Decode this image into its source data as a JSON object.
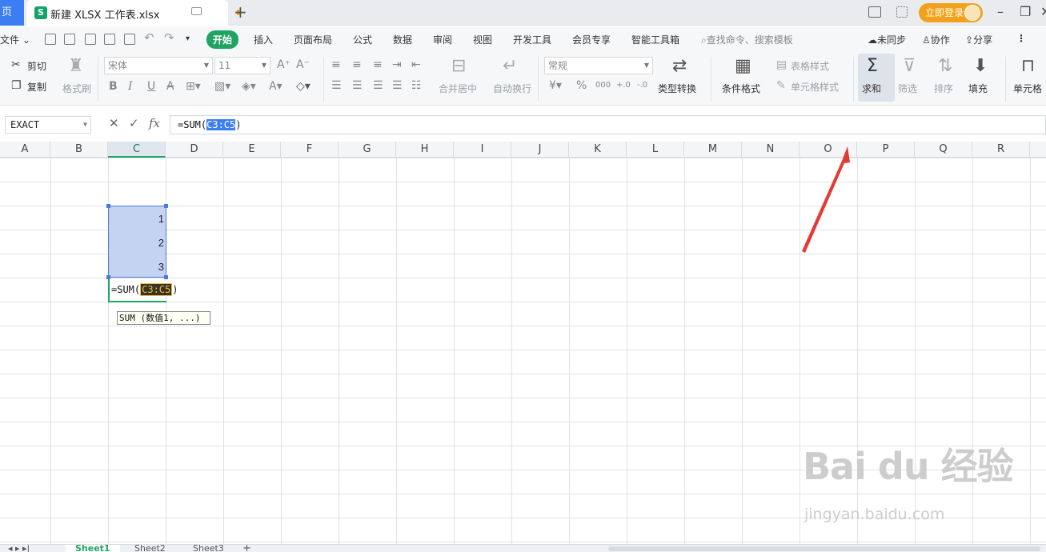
{
  "titlebar": {
    "home_label": "页",
    "doc_icon": "S",
    "doc_title": "新建 XLSX 工作表.xlsx",
    "new_tab": "+",
    "login_label": "立即登录"
  },
  "menu": {
    "file": "文件",
    "tabs": [
      "开始",
      "插入",
      "页面布局",
      "公式",
      "数据",
      "审阅",
      "视图",
      "开发工具",
      "会员专享",
      "智能工具箱"
    ],
    "search_placeholder": "查找命令、搜索模板",
    "sync": "未同步",
    "collab": "协作",
    "share": "分享"
  },
  "ribbon": {
    "cut": "剪切",
    "copy": "复制",
    "format_painter": "格式刷",
    "font_name": "宋体",
    "font_size": "11",
    "merge_center": "合并居中",
    "wrap_text": "自动换行",
    "number_format": "常规",
    "type_convert": "类型转换",
    "cond_format": "条件格式",
    "table_style": "表格样式",
    "cell_style": "单元格样式",
    "sum": "求和",
    "filter": "筛选",
    "sort": "排序",
    "fill": "填充",
    "cell": "单元格"
  },
  "formula_bar": {
    "name_box": "EXACT",
    "fx": "fx",
    "formula_prefix": "=SUM(",
    "formula_ref": "C3:C5",
    "formula_suffix": ")"
  },
  "sheet": {
    "columns": [
      "A",
      "B",
      "C",
      "D",
      "E",
      "F",
      "G",
      "H",
      "I",
      "J",
      "K",
      "L",
      "M",
      "N",
      "O",
      "P",
      "Q",
      "R"
    ],
    "active_column": "C",
    "cells": [
      "1",
      "2",
      "3"
    ],
    "edit_prefix": "=SUM(",
    "edit_ref": "C3:C5",
    "edit_suffix": ")",
    "tooltip": "SUM (数值1, ...)"
  },
  "watermark": {
    "line1": "Bai du 经验",
    "line2": "jingyan.baidu.com"
  },
  "sheet_tabs": [
    "Sheet1",
    "Sheet2",
    "Sheet3"
  ],
  "colors": {
    "accent_green": "#1fa463",
    "selection_fill": "#c5d3f3",
    "annotation_arrow": "#e53935"
  }
}
